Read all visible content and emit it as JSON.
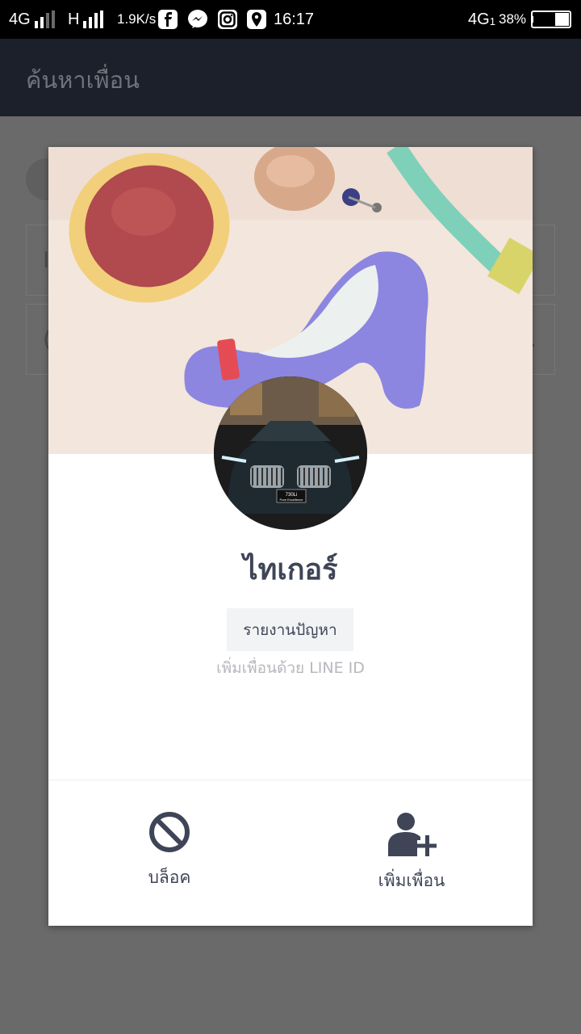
{
  "status_bar": {
    "network_left": "4G",
    "network_h": "H",
    "speed": "1.9K/s",
    "time": "16:17",
    "network_right": "4G",
    "network_right_sub": "1",
    "battery": "38%",
    "notification_icons": [
      "facebook-icon",
      "messenger-icon",
      "instagram-icon",
      "maps-icon"
    ]
  },
  "app_bar": {
    "title": "ค้นหาเพื่อน"
  },
  "profile": {
    "name": "ไทเกอร์",
    "report_label": "รายงานปัญหา",
    "line_id_note": "เพิ่มเพื่อนด้วย LINE ID",
    "avatar_plate": "730Li",
    "avatar_plate_sub": "Pure Excellence"
  },
  "actions": {
    "block_label": "บล็อค",
    "add_friend_label": "เพิ่มเพื่อน"
  },
  "colors": {
    "accent": "#3f4557",
    "app_bar_bg": "#1b202a",
    "overlay_bg": "#6a6a6a"
  }
}
